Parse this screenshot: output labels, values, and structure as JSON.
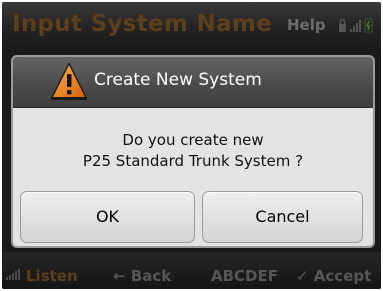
{
  "header": {
    "title": "Input System Name",
    "help_label": "Help",
    "status_icons": [
      "lock-icon",
      "signal-bars-icon",
      "battery-icon"
    ]
  },
  "dialog": {
    "title": "Create New System",
    "icon": "warning-icon",
    "message_line1": "Do you create new",
    "message_line2": "P25 Standard Trunk System ?",
    "ok_label": "OK",
    "cancel_label": "Cancel"
  },
  "softkeys": {
    "listen": "Listen",
    "back": "← Back",
    "abc": "ABCDEF",
    "accept": "✓ Accept"
  },
  "colors": {
    "accent_orange": "#e07a1a",
    "title_dim": "#5e3f1c"
  }
}
